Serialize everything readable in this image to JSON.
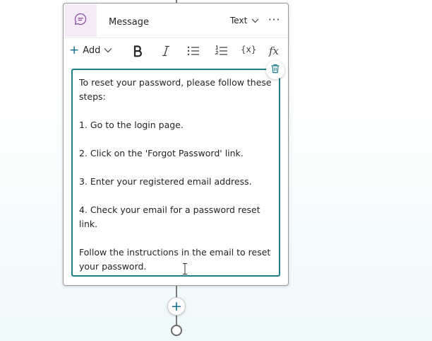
{
  "node": {
    "title": "Message",
    "type_select": {
      "value": "Text"
    },
    "more_glyph": "···",
    "toolbar": {
      "add_label": "Add",
      "variable_label": "{x}",
      "formula_label": "fx"
    },
    "editor": {
      "paragraphs": [
        "To reset your password, please follow these steps:",
        "1. Go to the login page.",
        "2. Click on the 'Forgot Password' link.",
        "3. Enter your registered email address.",
        "4. Check your email for a password reset link.",
        "Follow the instructions in the email to reset your password."
      ]
    }
  },
  "canvas": {
    "add_node_glyph": "+"
  },
  "colors": {
    "accent": "#0f6c8f",
    "editor_border": "#1f7d8f",
    "header_icon_bg": "#f5eaf7",
    "header_icon": "#8a4fa3"
  }
}
